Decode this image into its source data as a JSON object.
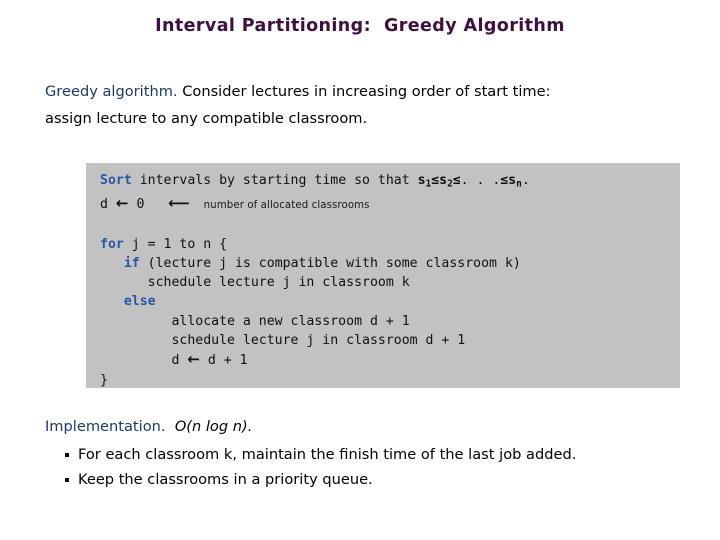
{
  "slide": {
    "title": "Interval Partitioning:  Greedy Algorithm",
    "title_color": "#3f0f3f",
    "accent_blue": "#1b3a6b",
    "code_keyword_blue": "#2855a8",
    "code_bg": "#c2c2c2",
    "background": "#ffffff"
  },
  "intro": {
    "lead": "Greedy algorithm.",
    "line1": "  Consider lectures in increasing order of start time:",
    "line2": "assign lecture to any compatible classroom."
  },
  "code": {
    "line1": {
      "keyword": "Sort",
      "rest_a": " intervals by starting time so that ",
      "s1": "s",
      "sub1": "1",
      "le1": "≤",
      "s2": "s",
      "sub2": "2",
      "le2": "≤",
      "dots": ". . .",
      "le3": "≤",
      "sn": "s",
      "subn": "n",
      "period": "."
    },
    "line2": {
      "var": "d",
      "arrow": "←",
      "value": "0",
      "annot_arrow": "⟵",
      "annotation": "number of allocated classrooms"
    },
    "line3": {
      "keyword": "for",
      "rest": " j = 1 to n {"
    },
    "line4": {
      "indent": "   ",
      "keyword": "if",
      "rest": " (lecture j is compatible with some classroom k)"
    },
    "line5": "      schedule lecture j in classroom k",
    "line6": {
      "indent": "   ",
      "keyword": "else"
    },
    "line7": "         allocate a new classroom d + 1",
    "line8": "         schedule lecture j in classroom d + 1",
    "line9": {
      "indent": "         ",
      "var": "d",
      "arrow": "←",
      "rest": " d + 1"
    },
    "line10": "}"
  },
  "implementation": {
    "lead": "Implementation.",
    "complexity": "O(n log n).",
    "bullets": [
      "For each classroom k, maintain the finish time of the last job added.",
      "Keep the classrooms in a priority queue."
    ]
  }
}
